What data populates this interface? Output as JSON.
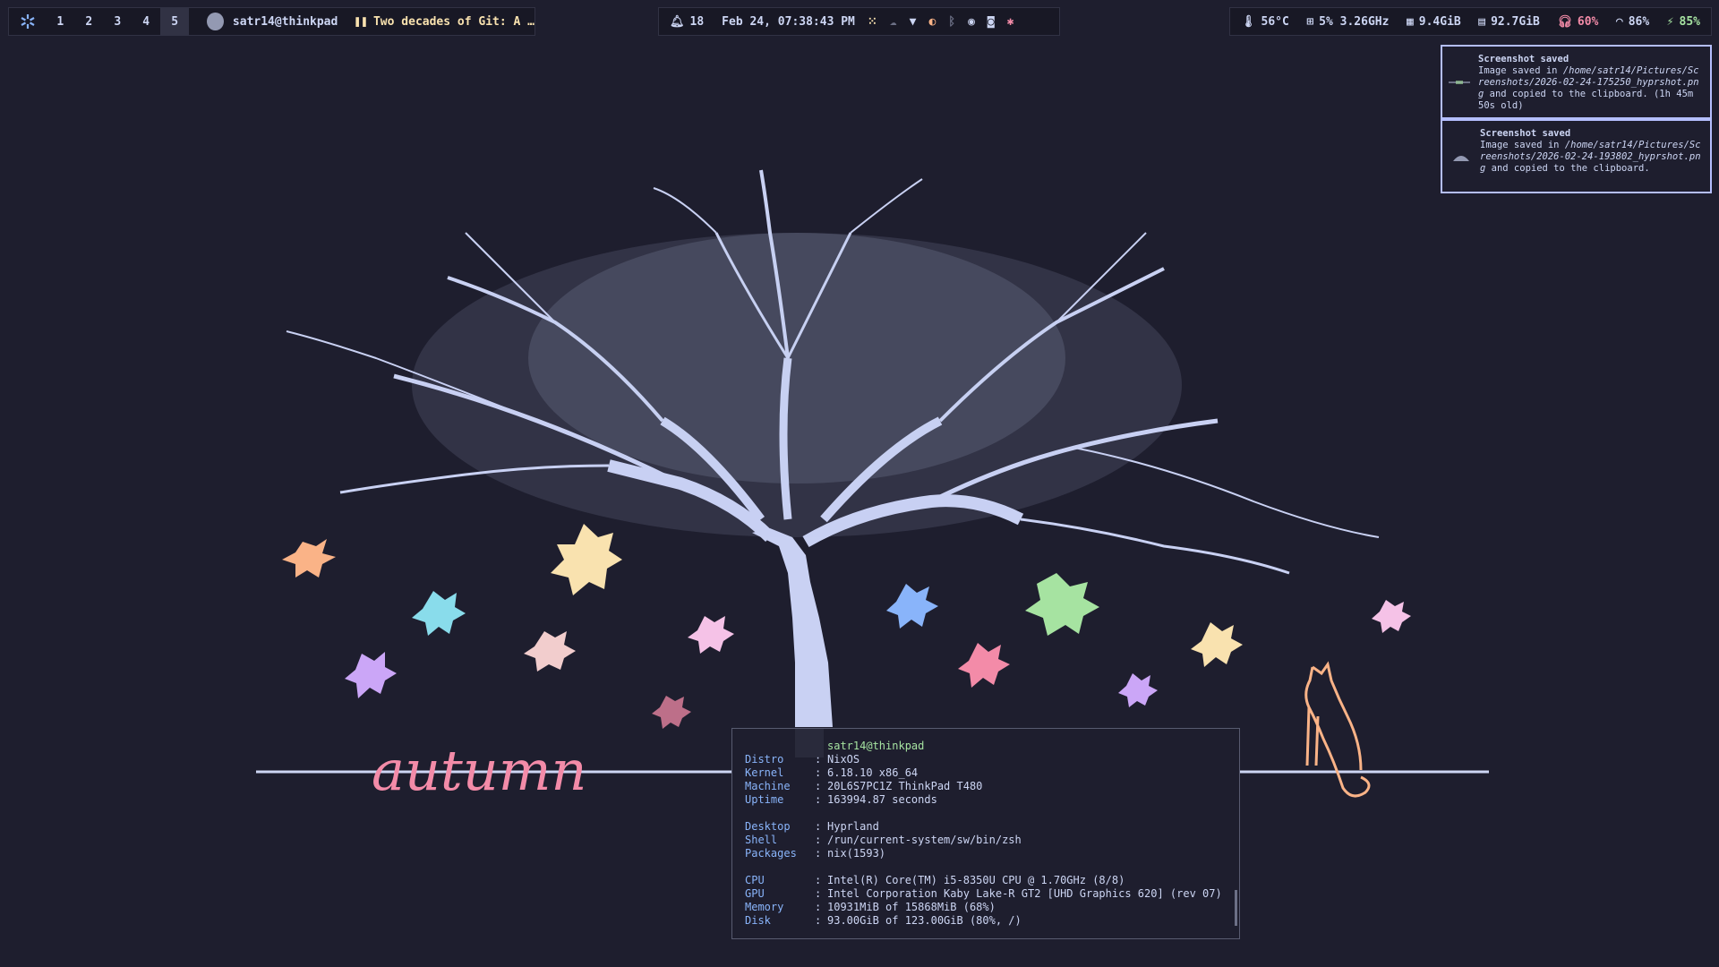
{
  "topbar": {
    "left": {
      "workspaces": [
        "1",
        "2",
        "3",
        "4",
        "5"
      ],
      "active_workspace": "5",
      "user_host": "satr14@thinkpad",
      "media": "Two decades of Git: A …"
    },
    "center": {
      "notifications_count": "18",
      "clock": "Feb 24, 07:38:43 PM",
      "tray_icons": [
        "grid-icon",
        "cloud-icon",
        "wifi-icon",
        "firefox-icon",
        "bluetooth-icon",
        "steam-icon",
        "discord-icon",
        "slack-icon"
      ]
    },
    "right": {
      "temperature": "56°C",
      "cpu": "5% 3.26GHz",
      "memory": "9.4GiB",
      "disk": "92.7GiB",
      "headphones": "60%",
      "wifi": "86%",
      "battery": "85%"
    }
  },
  "notifications": [
    {
      "summary": "Screenshot saved",
      "body_prefix": "Image saved in ",
      "path": "/home/satr14/Pictures/Screenshots/2026-02-24-175250_hyprshot.png",
      "body_suffix": " and copied to the clipboard. (1h 45m 50s old)"
    },
    {
      "summary": "Screenshot saved",
      "body_prefix": "Image saved in ",
      "path": "/home/satr14/Pictures/Screenshots/2026-02-24-193802_hyprshot.png",
      "body_suffix": " and copied to the clipboard."
    }
  ],
  "wallpaper": {
    "caption": "autumn",
    "colors": {
      "tree": "#c9d1f3",
      "caption": "#f38ba8",
      "cat": "#fab387",
      "line": "#cdd6f4"
    }
  },
  "fetch": {
    "host": "satr14@thinkpad",
    "groups": [
      [
        {
          "k": "Distro",
          "v": "NixOS"
        },
        {
          "k": "Kernel",
          "v": "6.18.10 x86_64"
        },
        {
          "k": "Machine",
          "v": "20L6S7PC1Z ThinkPad T480"
        },
        {
          "k": "Uptime",
          "v": "163994.87 seconds"
        }
      ],
      [
        {
          "k": "Desktop",
          "v": "Hyprland"
        },
        {
          "k": "Shell",
          "v": "/run/current-system/sw/bin/zsh"
        },
        {
          "k": "Packages",
          "v": "nix(1593)"
        }
      ],
      [
        {
          "k": "CPU",
          "v": "Intel(R) Core(TM) i5-8350U CPU @ 1.70GHz (8/8)"
        },
        {
          "k": "GPU",
          "v": "Intel Corporation Kaby Lake-R GT2 [UHD Graphics 620] (rev 07)"
        },
        {
          "k": "Memory",
          "v": "10931MiB of 15868MiB (68%)"
        },
        {
          "k": "Disk",
          "v": "93.00GiB of 123.00GiB (80%, /)"
        }
      ]
    ],
    "separator": ":"
  }
}
